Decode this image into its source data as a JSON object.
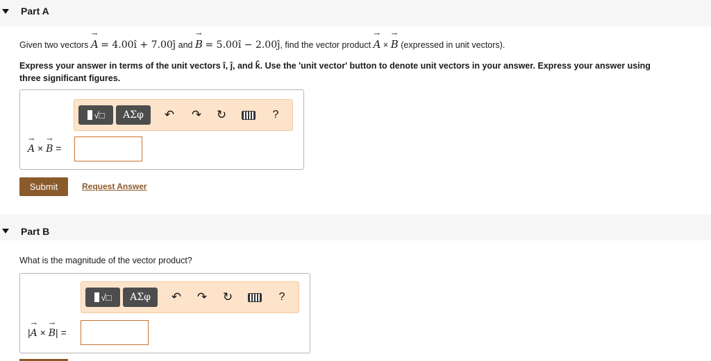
{
  "partA": {
    "title": "Part A",
    "question": {
      "prefix": "Given two vectors",
      "vecA": "A",
      "eqA": "= 4.00î + 7.00ĵ",
      "and": "and",
      "vecB": "B",
      "eqB": "= 5.00î − 2.00ĵ",
      "suffix1": ", find the vector product",
      "cross": "×",
      "suffix2": "(expressed in unit vectors)."
    },
    "instruction_line1": "Express your answer in terms of the unit vectors î, ĵ, and k̂. Use the 'unit vector' button to denote unit vectors in your answer. Express your answer using",
    "instruction_line2": "three significant figures.",
    "answer_label": {
      "vecA": "A",
      "cross": "×",
      "vecB": "B",
      "eq": "="
    },
    "answer_value": "",
    "submit_label": "Submit",
    "request_label": "Request Answer"
  },
  "partB": {
    "title": "Part B",
    "question": "What is the magnitude of the vector product?",
    "answer_label": {
      "open": "|",
      "vecA": "A",
      "cross": "×",
      "vecB": "B",
      "close": "|",
      "eq": "="
    },
    "answer_value": ""
  },
  "toolbar": {
    "templates_icon": "template-icon",
    "greek_label": "ΑΣφ",
    "undo_icon": "undo-icon",
    "redo_icon": "redo-icon",
    "reset_icon": "reset-icon",
    "keyboard_icon": "keyboard-icon",
    "help_label": "?"
  },
  "colors": {
    "accent": "#8b5a2b",
    "toolbar_bg": "#fde3c9",
    "input_border": "#c8722e"
  }
}
